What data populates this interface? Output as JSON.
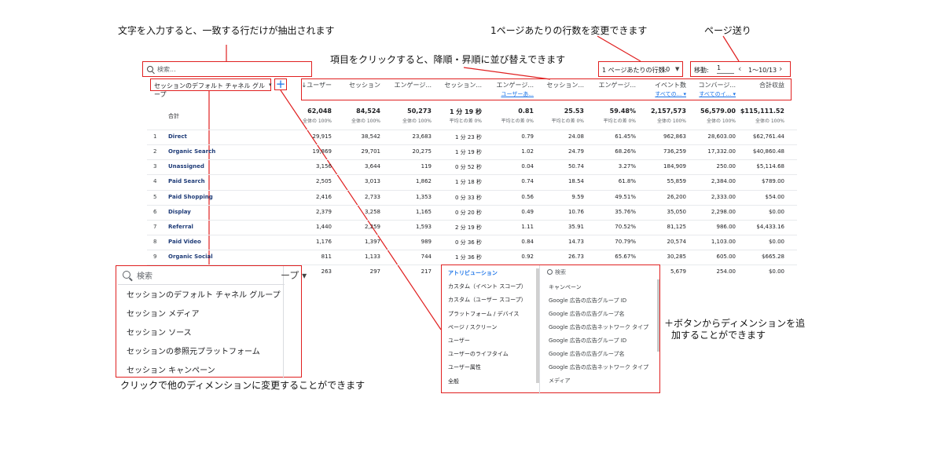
{
  "annotations": {
    "search": "文字を入力すると、一致する行だけが抽出されます",
    "rows_per_page": "1ページあたりの行数を変更できます",
    "paging": "ページ送り",
    "sort": "項目をクリックすると、降順・昇順に並び替えできます",
    "change_dimension": "クリックで他のディメンションに変更することができます",
    "add_dimension_line1": "＋ボタンからディメンションを追",
    "add_dimension_line2": "加することができます"
  },
  "toolbar": {
    "search_placeholder": "検索...",
    "rows_per_page_label": "1 ページあたりの行数:",
    "rows_per_page_value": "10",
    "goto_label": "移動:",
    "goto_value": "1",
    "page_range": "1～10/13",
    "prev_icon": "chevron-left-icon",
    "next_icon": "chevron-right-icon",
    "dimension_label": "セッションのデフォルト チャネル グループ",
    "add_label": "+"
  },
  "table": {
    "headers": [
      {
        "label": "↓ユーザー",
        "sub": ""
      },
      {
        "label": "セッション",
        "sub": ""
      },
      {
        "label": "エンゲージ...",
        "sub": ""
      },
      {
        "label": "セッション...",
        "sub": ""
      },
      {
        "label": "エンゲージ...",
        "sub": "ユーザーあ..."
      },
      {
        "label": "セッション...",
        "sub": ""
      },
      {
        "label": "エンゲージ...",
        "sub": ""
      },
      {
        "label": "イベント数",
        "sub": "すべての... ▾"
      },
      {
        "label": "コンバージ...",
        "sub": "すべてのイ... ▾"
      },
      {
        "label": "合計収益",
        "sub": ""
      }
    ],
    "total_label": "合計",
    "totals": [
      {
        "value": "62,048",
        "sub": "全体の 100%"
      },
      {
        "value": "84,524",
        "sub": "全体の 100%"
      },
      {
        "value": "50,273",
        "sub": "全体の 100%"
      },
      {
        "value": "1 分 19 秒",
        "sub": "平均との差 0%"
      },
      {
        "value": "0.81",
        "sub": "平均との差 0%"
      },
      {
        "value": "25.53",
        "sub": "平均との差 0%"
      },
      {
        "value": "59.48%",
        "sub": "平均との差 0%"
      },
      {
        "value": "2,157,573",
        "sub": "全体の 100%"
      },
      {
        "value": "56,579.00",
        "sub": "全体の 100%"
      },
      {
        "value": "$115,111.52",
        "sub": "全体の 100%"
      }
    ],
    "rows": [
      {
        "n": "1",
        "label": "Direct",
        "v": [
          "29,915",
          "38,542",
          "23,683",
          "1 分 23 秒",
          "0.79",
          "24.08",
          "61.45%",
          "962,863",
          "28,603.00",
          "$62,761.44"
        ]
      },
      {
        "n": "2",
        "label": "Organic Search",
        "v": [
          "19,869",
          "29,701",
          "20,275",
          "1 分 19 秒",
          "1.02",
          "24.79",
          "68.26%",
          "736,259",
          "17,332.00",
          "$40,860.48"
        ]
      },
      {
        "n": "3",
        "label": "Unassigned",
        "v": [
          "3,156",
          "3,644",
          "119",
          "0 分 52 秒",
          "0.04",
          "50.74",
          "3.27%",
          "184,909",
          "250.00",
          "$5,114.68"
        ]
      },
      {
        "n": "4",
        "label": "Paid Search",
        "v": [
          "2,505",
          "3,013",
          "1,862",
          "1 分 18 秒",
          "0.74",
          "18.54",
          "61.8%",
          "55,859",
          "2,384.00",
          "$789.00"
        ]
      },
      {
        "n": "5",
        "label": "Paid Shopping",
        "v": [
          "2,416",
          "2,733",
          "1,353",
          "0 分 33 秒",
          "0.56",
          "9.59",
          "49.51%",
          "26,200",
          "2,333.00",
          "$54.00"
        ]
      },
      {
        "n": "6",
        "label": "Display",
        "v": [
          "2,379",
          "3,258",
          "1,165",
          "0 分 20 秒",
          "0.49",
          "10.76",
          "35.76%",
          "35,050",
          "2,298.00",
          "$0.00"
        ]
      },
      {
        "n": "7",
        "label": "Referral",
        "v": [
          "1,440",
          "2,259",
          "1,593",
          "2 分 19 秒",
          "1.11",
          "35.91",
          "70.52%",
          "81,125",
          "986.00",
          "$4,433.16"
        ]
      },
      {
        "n": "8",
        "label": "Paid Video",
        "v": [
          "1,176",
          "1,397",
          "989",
          "0 分 36 秒",
          "0.84",
          "14.73",
          "70.79%",
          "20,574",
          "1,103.00",
          "$0.00"
        ]
      },
      {
        "n": "9",
        "label": "Organic Social",
        "v": [
          "811",
          "1,133",
          "744",
          "1 分 36 秒",
          "0.92",
          "26.73",
          "65.67%",
          "30,285",
          "605.00",
          "$665.28"
        ]
      },
      {
        "n": "",
        "label": "",
        "v": [
          "263",
          "297",
          "217",
          "",
          "",
          "",
          "",
          "5,679",
          "254.00",
          "$0.00"
        ]
      }
    ]
  },
  "dimension_menu": {
    "search_label": "検索",
    "options": [
      "セッションのデフォルト チャネル グループ",
      "セッション メディア",
      "セッション ソース",
      "セッションの参照元プラットフォーム",
      "セッション キャンペーン"
    ],
    "behind_text": "ープ ▾"
  },
  "add_menu": {
    "categories": [
      "アトリビューション",
      "カスタム（イベント スコープ）",
      "カスタム（ユーザー スコープ）",
      "プラットフォーム / デバイス",
      "ページ / スクリーン",
      "ユーザー",
      "ユーザーのライフタイム",
      "ユーザー属性",
      "全般"
    ],
    "search_label": "検索",
    "items": [
      "キャンペーン",
      "Google 広告の広告グループ ID",
      "Google 広告の広告グループ名",
      "Google 広告の広告ネットワーク タイプ",
      "Google 広告の広告グループ ID",
      "Google 広告の広告グループ名",
      "Google 広告の広告ネットワーク タイプ",
      "メディア"
    ]
  }
}
